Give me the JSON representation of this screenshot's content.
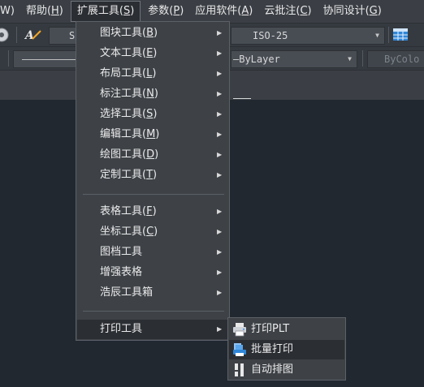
{
  "menubar": [
    {
      "label": "W)",
      "name": "menu-window-partial"
    },
    {
      "label": "帮助(H)",
      "name": "menu-help"
    },
    {
      "label": "扩展工具(S)",
      "name": "menu-extension-tools"
    },
    {
      "label": "参数(P)",
      "name": "menu-parameters"
    },
    {
      "label": "应用软件(A)",
      "name": "menu-applications"
    },
    {
      "label": "云批注(C)",
      "name": "menu-cloud-annotation"
    },
    {
      "label": "协同设计(G)",
      "name": "menu-collaborative-design"
    }
  ],
  "toolbar": {
    "style_partial": "S",
    "dimstyle_value": "ISO-25",
    "line_partial": "—",
    "layer_value": "ByLayer",
    "color_partial": "ByColo"
  },
  "dropdown": {
    "items": [
      {
        "label": "图块工具(B)",
        "has_sub": true
      },
      {
        "label": "文本工具(E)",
        "has_sub": true
      },
      {
        "label": "布局工具(L)",
        "has_sub": true
      },
      {
        "label": "标注工具(N)",
        "has_sub": true
      },
      {
        "label": "选择工具(S)",
        "has_sub": true
      },
      {
        "label": "编辑工具(M)",
        "has_sub": true
      },
      {
        "label": "绘图工具(D)",
        "has_sub": true
      },
      {
        "label": "定制工具(T)",
        "has_sub": true
      },
      {
        "label": "表格工具(F)",
        "has_sub": true
      },
      {
        "label": "坐标工具(C)",
        "has_sub": true
      },
      {
        "label": "图档工具",
        "has_sub": true
      },
      {
        "label": "增强表格",
        "has_sub": true
      },
      {
        "label": "浩辰工具箱",
        "has_sub": true
      },
      {
        "label": "打印工具",
        "has_sub": true
      }
    ],
    "arrow_glyph": "▶"
  },
  "submenu": {
    "items": [
      {
        "label": "打印PLT",
        "icon": "printer-icon"
      },
      {
        "label": "批量打印",
        "icon": "batch-print-icon"
      },
      {
        "label": "自动排图",
        "icon": "auto-arrange-icon"
      }
    ]
  }
}
